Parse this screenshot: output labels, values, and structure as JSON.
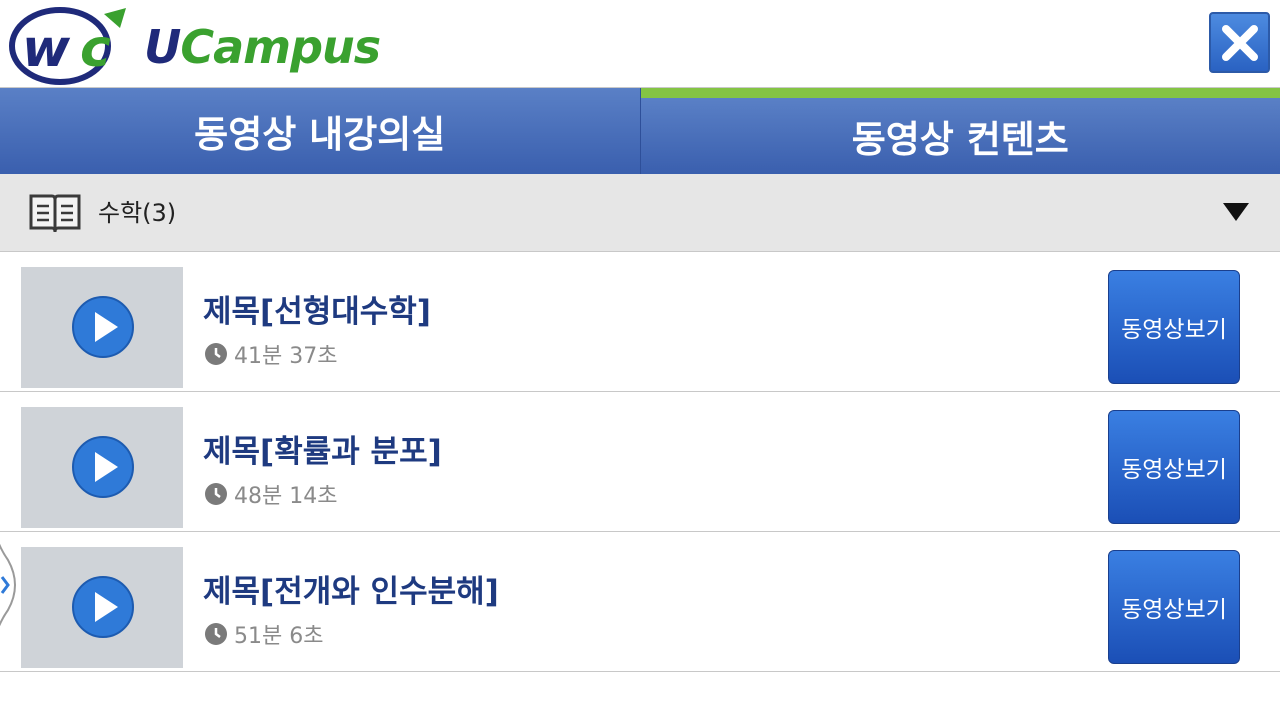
{
  "header": {
    "logo_mark": "wc",
    "logo_text_u": "U",
    "logo_text_rest": "Campus",
    "close_icon": "close-x-icon"
  },
  "tabs": [
    {
      "label": "동영상 내강의실",
      "active": false
    },
    {
      "label": "동영상 컨텐츠",
      "active": true
    }
  ],
  "category": {
    "icon": "book-icon",
    "label": "수학(3)",
    "arrow": "triangle-down-icon"
  },
  "videos": [
    {
      "title": "제목[선형대수학]",
      "duration": "41분 37초",
      "button": "동영상보기"
    },
    {
      "title": "제목[확률과 분포]",
      "duration": "48분 14초",
      "button": "동영상보기"
    },
    {
      "title": "제목[전개와 인수분해]",
      "duration": "51분 6초",
      "button": "동영상보기"
    }
  ],
  "colors": {
    "tab_bg": "#4a6fbb",
    "tab_active_indicator": "#84c444",
    "title_text": "#1e3a80",
    "button_bg": "#2a62c8",
    "logo_green": "#3aa12f",
    "logo_navy": "#1f2a7a"
  }
}
